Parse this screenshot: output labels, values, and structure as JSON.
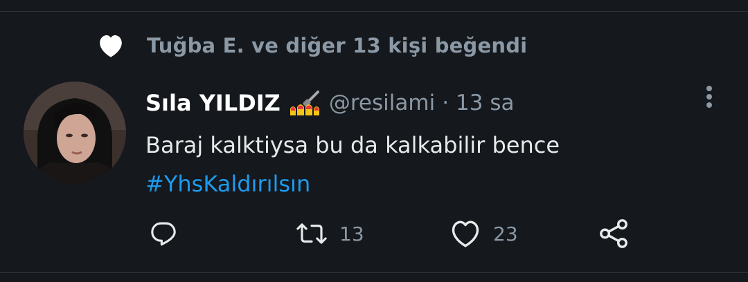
{
  "social_context": {
    "icon": "heart-filled-icon",
    "text": "Tuğba E. ve diğer 13 kişi beğendi"
  },
  "author": {
    "display_name": "Sıla YILDIZ",
    "emoji": "nail-polish-emoji",
    "handle": "@resilami",
    "separator": "·",
    "time": "13 sa"
  },
  "tweet": {
    "text": "Baraj kalktiysa bu da kalkabilir bence",
    "hashtag": "#YhsKaldırılsın"
  },
  "actions": {
    "reply": {
      "icon": "reply-icon",
      "count": ""
    },
    "retweet": {
      "icon": "retweet-icon",
      "count": "13"
    },
    "like": {
      "icon": "heart-icon",
      "count": "23"
    },
    "share": {
      "icon": "share-icon"
    }
  },
  "colors": {
    "background": "#15181c",
    "text_primary": "#e7e9ea",
    "text_secondary": "#8b98a5",
    "link": "#1d9bf0",
    "divider": "#2f3336"
  }
}
